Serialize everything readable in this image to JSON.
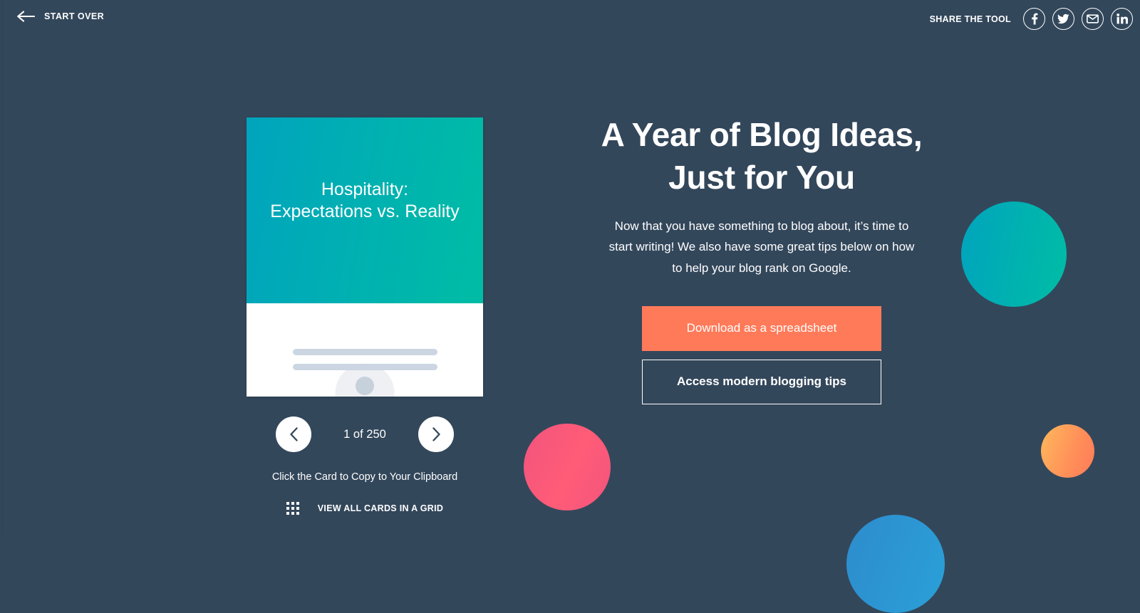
{
  "topbar": {
    "start_over_label": "START OVER",
    "back_icon": "arrow-left-icon",
    "share_label": "SHARE THE TOOL",
    "share_icons": [
      {
        "name": "facebook-icon",
        "label": "Facebook"
      },
      {
        "name": "twitter-icon",
        "label": "Twitter"
      },
      {
        "name": "email-icon",
        "label": "Email"
      },
      {
        "name": "linkedin-icon",
        "label": "LinkedIn"
      }
    ]
  },
  "card": {
    "title": "Hospitality:\nExpectations vs. Reality",
    "title_line1": "Hospitality:",
    "title_line2": "Expectations vs. Reality",
    "avatar_icon": "person-avatar-icon",
    "gradient_start": "#00a4bd",
    "gradient_end": "#00bda5",
    "placeholder_line_color": "#cbd6e2"
  },
  "nav": {
    "prev_icon": "chevron-left-icon",
    "next_icon": "chevron-right-icon",
    "counter": "1 of 250",
    "current_index": 1,
    "total": 250,
    "copy_hint": "Click the Card to Copy to Your Clipboard",
    "grid_icon": "grid-dots-icon",
    "grid_link_label": "VIEW ALL CARDS IN A GRID"
  },
  "hero": {
    "title_line1": "A Year of Blog Ideas,",
    "title_line2": "Just for You",
    "subtitle": "Now that you have something to blog about, it’s time to start writing! We also have some great tips below on how to help your blog rank on Google.",
    "primary_cta": "Download as a spreadsheet",
    "secondary_cta": "Access modern blogging tips"
  },
  "theme": {
    "background": "#33475b",
    "accent_orange": "#ff7a59",
    "accent_teal": "#00bda5",
    "accent_pink": "#f2547d",
    "accent_blue": "#2e8ccc"
  }
}
